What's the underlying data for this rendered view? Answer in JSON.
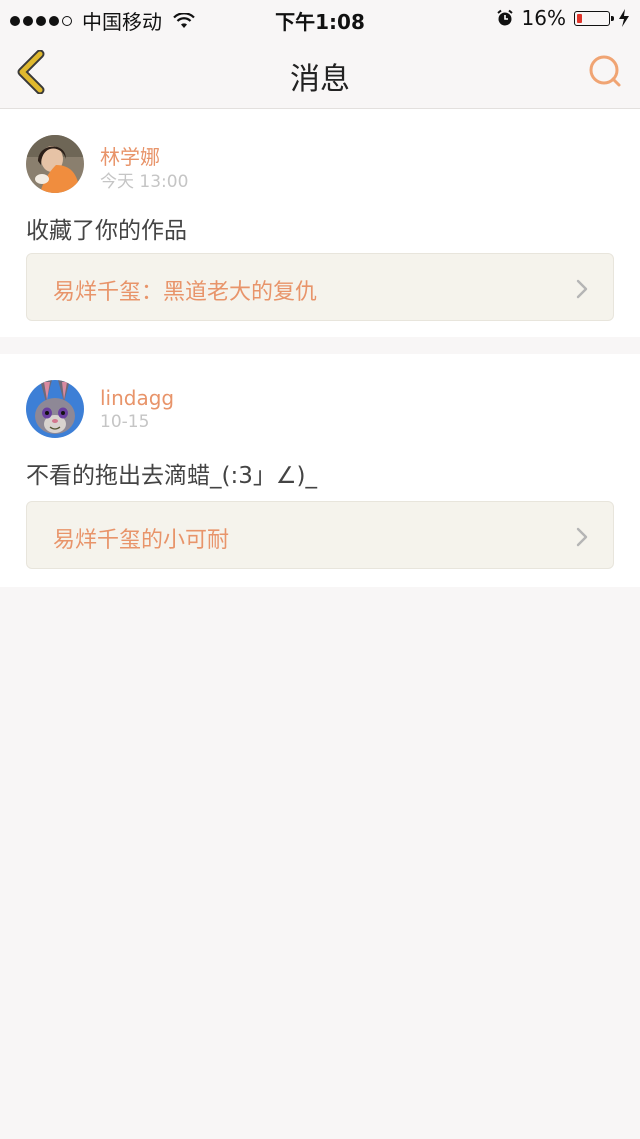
{
  "status_bar": {
    "carrier": "中国移动",
    "time": "下午1:08",
    "battery_percent": "16%",
    "battery_level": 0.16,
    "signal_bars_filled": 4,
    "icons": [
      "signal-dots-icon",
      "wifi-icon",
      "alarm-icon",
      "battery-icon",
      "charging-bolt-icon"
    ]
  },
  "nav": {
    "title": "消息",
    "back_icon": "chevron-left-icon",
    "search_icon": "search-icon"
  },
  "messages": [
    {
      "username": "林学娜",
      "time": "今天 13:00",
      "text": "收藏了你的作品",
      "work_title": "易烊千玺：黑道老大的复仇"
    },
    {
      "username": "lindagg",
      "time": "10-15",
      "text": "不看的拖出去滴蜡_(:3」∠)_",
      "work_title": "易烊千玺的小可耐"
    }
  ],
  "colors": {
    "accent": "#e8946a",
    "background": "#f8f6f6",
    "card": "#ffffff",
    "link_bg": "#f5f3ec",
    "back_icon": "#e0b92e",
    "battery_low": "#e0352b"
  }
}
